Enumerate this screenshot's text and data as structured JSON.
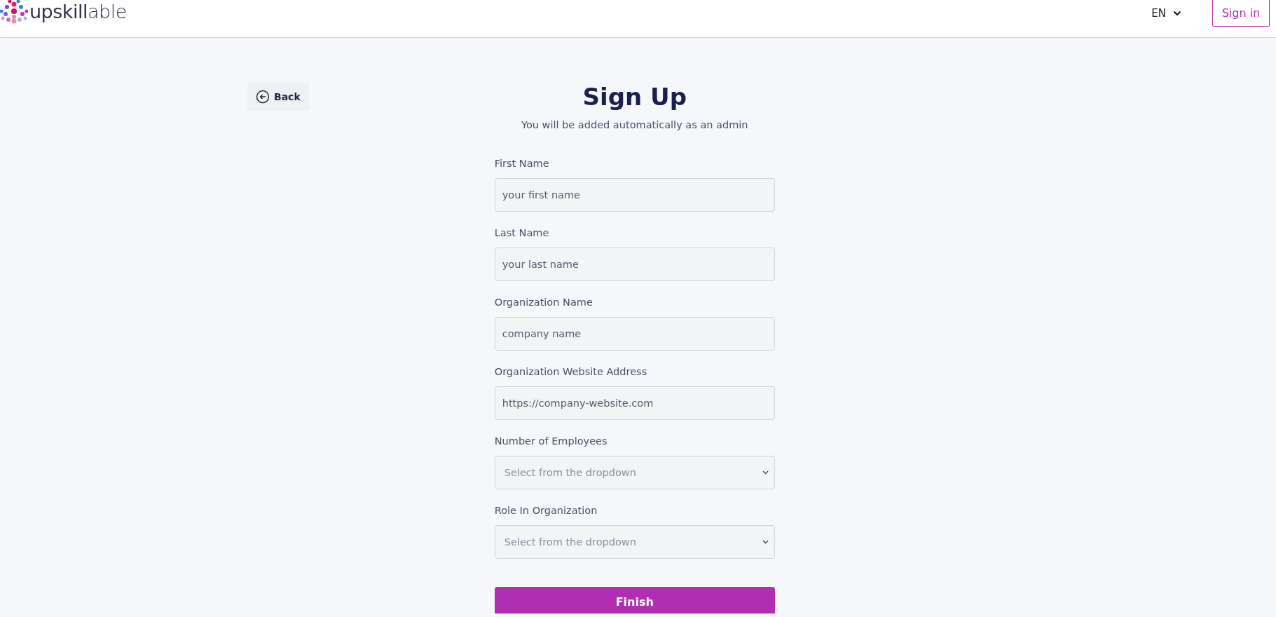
{
  "header": {
    "logo": "**upskill**able",
    "language": "EN",
    "sign_in": "Sign in"
  },
  "back": "Back",
  "title": "Sign Up",
  "subtitle": "You will be added automatically as an admin",
  "fields": [
    {
      "kind": "text",
      "label": "First Name",
      "placeholder": "your first name"
    },
    {
      "kind": "text",
      "label": "Last Name",
      "placeholder": "your last name"
    },
    {
      "kind": "text",
      "label": "Organization Name",
      "placeholder": "company name"
    },
    {
      "kind": "text",
      "label": "Organization Website Address",
      "placeholder": "https://company-website.com"
    },
    {
      "kind": "select",
      "label": "Number of Employees",
      "placeholder": "Select from the dropdown"
    },
    {
      "kind": "select",
      "label": "Role In Organization",
      "placeholder": "Select from the dropdown"
    }
  ],
  "submit": "Finish"
}
